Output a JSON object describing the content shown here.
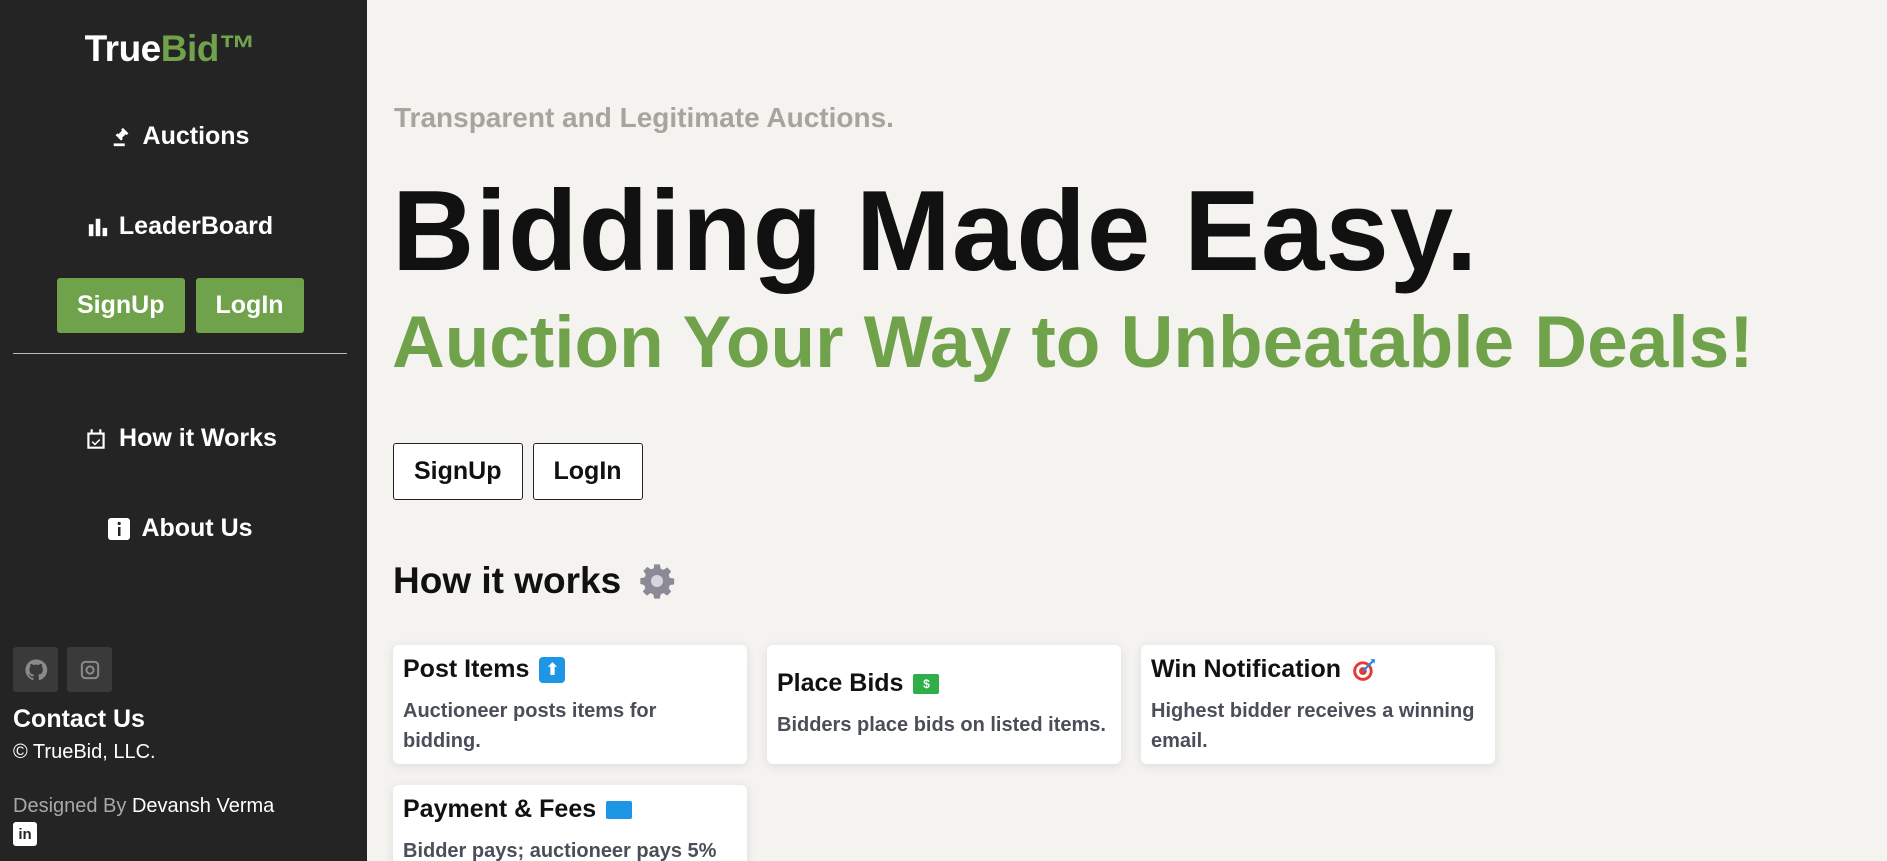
{
  "sidebar": {
    "logo": {
      "part1": "True",
      "part2": "Bid™"
    },
    "nav": {
      "auctions": "Auctions",
      "leaderboard": "LeaderBoard",
      "how_it_works": "How it Works",
      "about_us": "About Us"
    },
    "signup_label": "SignUp",
    "login_label": "LogIn",
    "contact_title": "Contact Us",
    "copyright": "© TrueBid, LLC.",
    "designed_by": "Designed By",
    "designer_name": "Devansh Verma",
    "social_icons": [
      "github-icon",
      "instagram-icon",
      "linkedin-icon"
    ]
  },
  "hero": {
    "tagline": "Transparent and Legitimate Auctions.",
    "headline": "Bidding Made Easy.",
    "subheadline": "Auction Your Way to Unbeatable Deals!",
    "signup_label": "SignUp",
    "login_label": "LogIn"
  },
  "how_it_works": {
    "title": "How it works",
    "cards": [
      {
        "title": "Post Items",
        "desc": "Auctioneer posts items for bidding.",
        "icon": "up-arrow-icon"
      },
      {
        "title": "Place Bids",
        "desc": "Bidders place bids on listed items.",
        "icon": "money-icon"
      },
      {
        "title": "Win Notification",
        "desc": "Highest bidder receives a winning email.",
        "icon": "target-icon"
      },
      {
        "title": "Payment & Fees",
        "desc": "Bidder pays; auctioneer pays 5%",
        "icon": "credit-card-icon"
      }
    ]
  },
  "colors": {
    "brand_green": "#6fa24a",
    "sidebar_bg": "#242424",
    "page_bg": "#f4f3ef"
  }
}
